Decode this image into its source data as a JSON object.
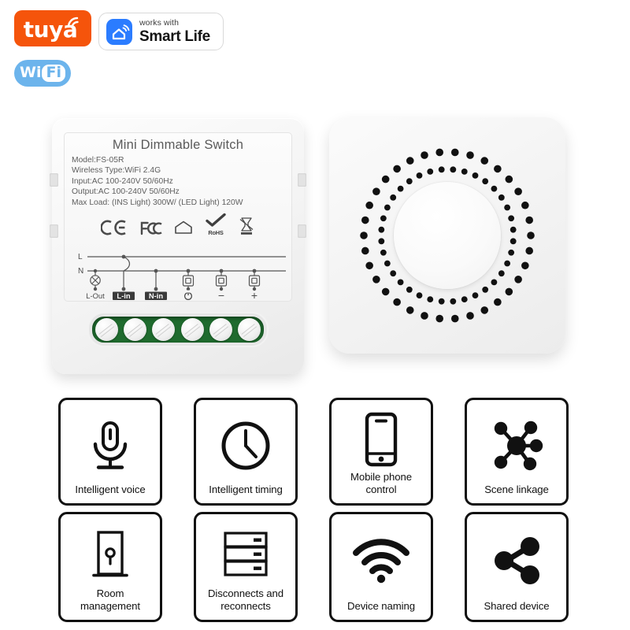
{
  "badges": {
    "tuya": {
      "name": "tuya",
      "icon": "tuya-wifi-wave-icon",
      "color": "#f5540b"
    },
    "wifi": {
      "wi": "Wi",
      "fi": "Fi",
      "color": "#6cb4ec"
    },
    "smart_life": {
      "works_with": "works with",
      "name": "Smart Life",
      "icon": "home-wifi-app-icon",
      "color": "#2b7cff"
    }
  },
  "device": {
    "title": "Mini Dimmable Switch",
    "specs": [
      "Model:FS-05R",
      "Wireless Type:WiFi 2.4G",
      "Input:AC 100-240V 50/60Hz",
      "Output:AC 100-240V 50/60Hz",
      "Max Load: (INS Light) 300W/ (LED Light) 120W"
    ],
    "certifications": [
      "CE",
      "FC",
      "house-mark",
      "RoHS",
      "WEEE"
    ],
    "rohs_label": "RoHS",
    "wiring": {
      "line_labels": [
        "L",
        "N"
      ],
      "terminals": [
        {
          "label": "L-Out",
          "highlighted": false,
          "symbol": "lamp"
        },
        {
          "label": "L-in",
          "highlighted": true,
          "symbol": "none"
        },
        {
          "label": "N-in",
          "highlighted": true,
          "symbol": "none"
        },
        {
          "label": "⏻",
          "highlighted": false,
          "symbol": "switch"
        },
        {
          "label": "−",
          "highlighted": false,
          "symbol": "switch"
        },
        {
          "label": "+",
          "highlighted": false,
          "symbol": "switch"
        }
      ]
    },
    "terminal_block": {
      "screw_count": 6,
      "color": "#1f6b2e"
    }
  },
  "dot_device": {
    "name": "dotted-panel-device",
    "center": "raised-circular-button",
    "ring_color": "#111111",
    "rings": [
      {
        "radius": 62,
        "count": 28,
        "dot_radius": 3.0
      },
      {
        "radius": 84,
        "count": 36,
        "dot_radius": 3.9
      },
      {
        "radius": 106,
        "count": 34,
        "dot_radius": 4.8
      }
    ]
  },
  "features": [
    {
      "label": "Intelligent voice",
      "icon": "microphone-icon"
    },
    {
      "label": "Intelligent timing",
      "icon": "clock-icon"
    },
    {
      "label": "Mobile phone\ncontrol",
      "icon": "smartphone-icon"
    },
    {
      "label": "Scene linkage",
      "icon": "network-hub-icon"
    },
    {
      "label": "Room\nmanagement",
      "icon": "door-icon"
    },
    {
      "label": "Disconnects and\nreconnects",
      "icon": "server-stack-icon"
    },
    {
      "label": "Device naming",
      "icon": "wifi-signal-icon"
    },
    {
      "label": "Shared device",
      "icon": "share-nodes-icon"
    }
  ]
}
